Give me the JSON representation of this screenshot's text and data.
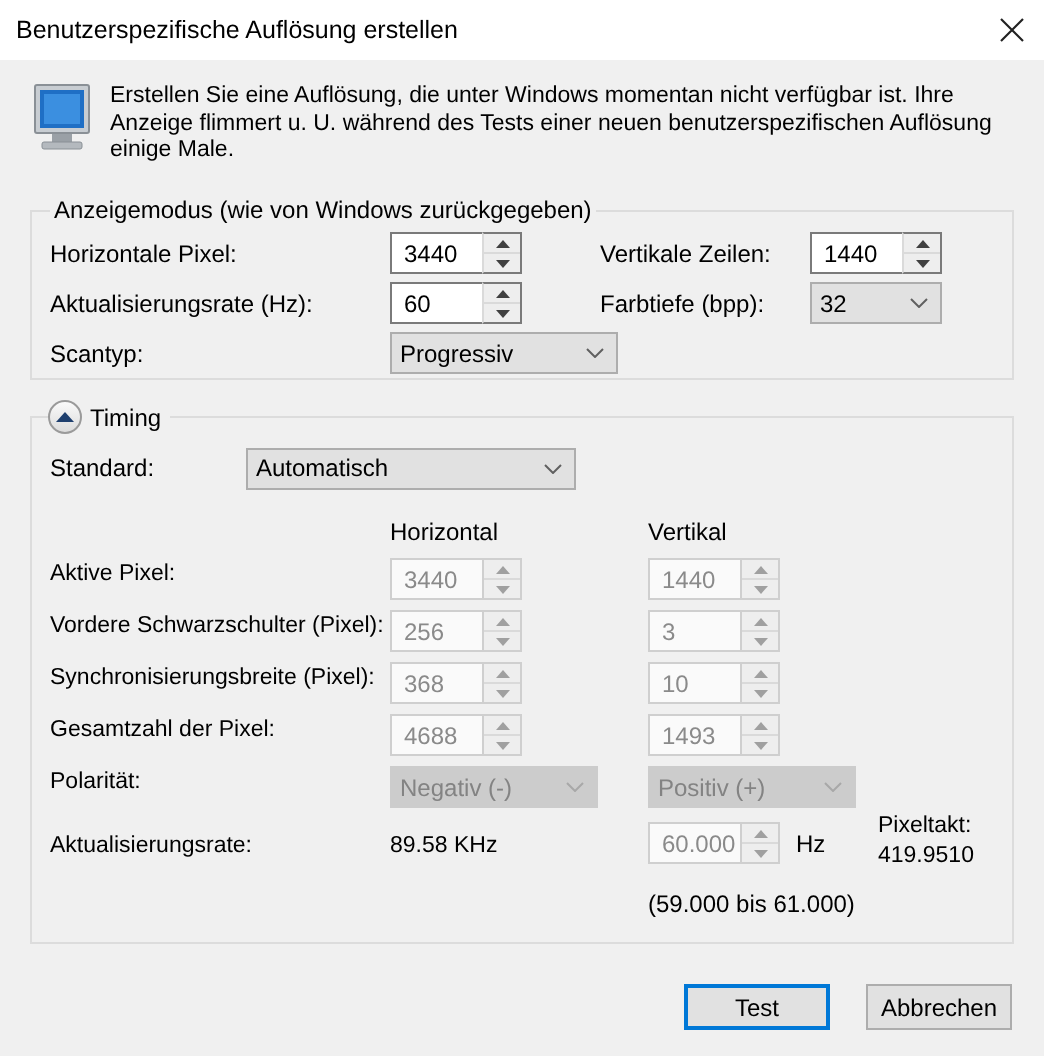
{
  "window": {
    "title": "Benutzerspezifische Auflösung erstellen"
  },
  "intro": "Erstellen Sie eine Auflösung, die unter Windows momentan nicht verfügbar ist. Ihre Anzeige flimmert u. U. während des Tests einer neuen benutzerspezifischen Auflösung einige Male.",
  "display_mode": {
    "legend": "Anzeigemodus (wie von Windows zurückgegeben)",
    "fields": [
      {
        "label": "Horizontale Pixel:",
        "kind": "spin",
        "value": "3440",
        "disabled": false
      },
      {
        "label": "Vertikale Zeilen:",
        "kind": "spin",
        "value": "1440",
        "disabled": false
      },
      {
        "label": "Aktualisierungsrate (Hz):",
        "kind": "spin",
        "value": "60",
        "disabled": false
      },
      {
        "label": "Farbtiefe (bpp):",
        "kind": "combo",
        "value": "32",
        "disabled": false
      },
      {
        "label": "Scantyp:",
        "kind": "combo",
        "value": "Progressiv",
        "disabled": false
      }
    ]
  },
  "timing": {
    "label": "Timing",
    "expanded": true,
    "standard": {
      "label": "Standard:",
      "value": "Automatisch",
      "disabled": false
    },
    "columns": [
      "Horizontal",
      "Vertikal"
    ],
    "rows": [
      {
        "label": "Aktive Pixel:",
        "kind": "spin",
        "horizontal": {
          "value": "3440",
          "disabled": true
        },
        "vertical": {
          "value": "1440",
          "disabled": true
        }
      },
      {
        "label": "Vordere Schwarzschulter (Pixel):",
        "kind": "spin",
        "horizontal": {
          "value": "256",
          "disabled": true
        },
        "vertical": {
          "value": "3",
          "disabled": true
        }
      },
      {
        "label": "Synchronisierungsbreite (Pixel):",
        "kind": "spin",
        "horizontal": {
          "value": "368",
          "disabled": true
        },
        "vertical": {
          "value": "10",
          "disabled": true
        }
      },
      {
        "label": "Gesamtzahl der Pixel:",
        "kind": "spin",
        "horizontal": {
          "value": "4688",
          "disabled": true
        },
        "vertical": {
          "value": "1493",
          "disabled": true
        }
      },
      {
        "label": "Polarität:",
        "kind": "combo",
        "horizontal": {
          "value": "Negativ (-)",
          "disabled": true
        },
        "vertical": {
          "value": "Positiv (+)",
          "disabled": true
        }
      }
    ],
    "refresh": {
      "label": "Aktualisierungsrate:",
      "horizontal": "89.58 KHz",
      "vertical": {
        "value": "60.000",
        "disabled": true
      },
      "unit": "Hz",
      "range": "(59.000 bis 61.000)"
    },
    "pixel_clock": {
      "label": "Pixeltakt:",
      "value": "419.9510"
    }
  },
  "buttons": [
    {
      "label": "Test",
      "default": true
    },
    {
      "label": "Abbrechen",
      "default": false
    }
  ]
}
